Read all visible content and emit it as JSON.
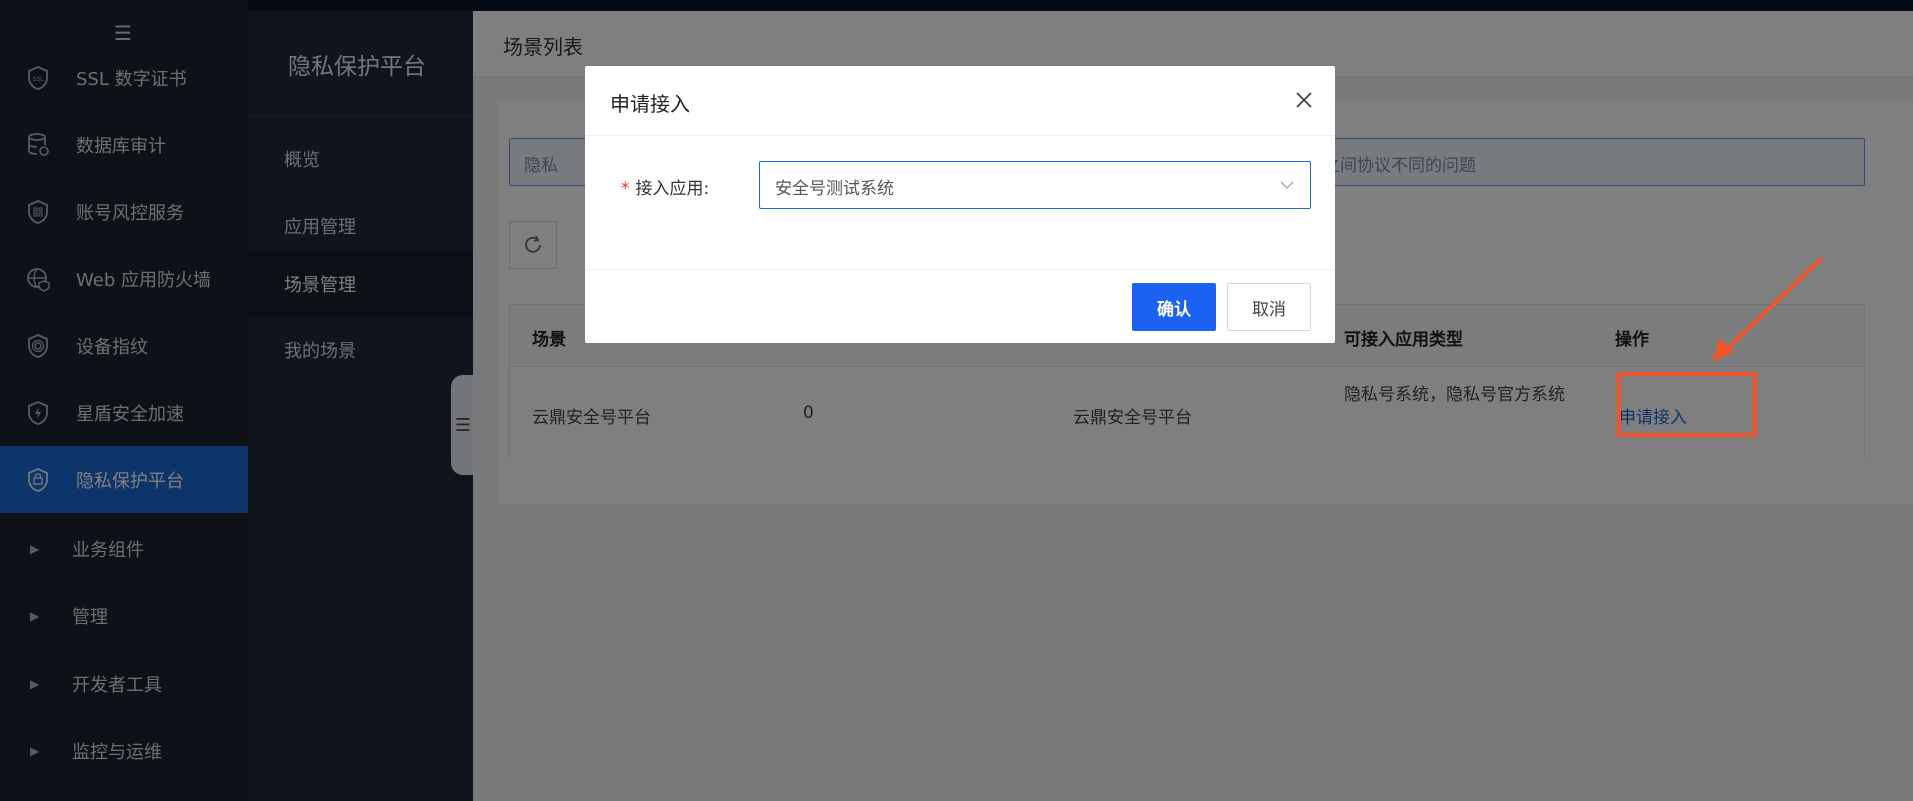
{
  "leftnav": {
    "items": [
      {
        "label": "SSL 数字证书",
        "icon": "shield-ssl-icon"
      },
      {
        "label": "数据库审计",
        "icon": "database-icon"
      },
      {
        "label": "账号风控服务",
        "icon": "shield-grid-icon"
      },
      {
        "label": "Web 应用防火墙",
        "icon": "globe-shield-icon"
      },
      {
        "label": "设备指纹",
        "icon": "fingerprint-shield-icon"
      },
      {
        "label": "星盾安全加速",
        "icon": "bolt-shield-icon"
      },
      {
        "label": "隐私保护平台",
        "icon": "privacy-shield-icon"
      }
    ],
    "groups": [
      {
        "label": "业务组件"
      },
      {
        "label": "管理"
      },
      {
        "label": "开发者工具"
      },
      {
        "label": "监控与运维"
      }
    ],
    "active_index": 6
  },
  "subnav": {
    "title": "隐私保护平台",
    "items": [
      {
        "label": "概览"
      },
      {
        "label": "应用管理"
      },
      {
        "label": "场景管理"
      },
      {
        "label": "我的场景"
      }
    ],
    "active_index": 2
  },
  "page": {
    "title": "场景列表",
    "notice_start": "隐私",
    "notice_end": "统之间协议不同的问题"
  },
  "table": {
    "headers": [
      "场景",
      "可接入应用类型",
      "操作"
    ],
    "rows": [
      {
        "name": "云鼎安全号平台",
        "count": "0",
        "platform": "云鼎安全号平台",
        "app_types": "隐私号系统，隐私号官方系统",
        "action": "申请接入"
      }
    ]
  },
  "modal": {
    "title": "申请接入",
    "field_required_mark": "*",
    "field_label": "接入应用:",
    "field_value": "安全号测试系统",
    "ok_label": "确认",
    "cancel_label": "取消"
  },
  "colors": {
    "accent": "#1b62f2",
    "highlight": "#f0542a",
    "nav_active": "#1b69d6"
  }
}
